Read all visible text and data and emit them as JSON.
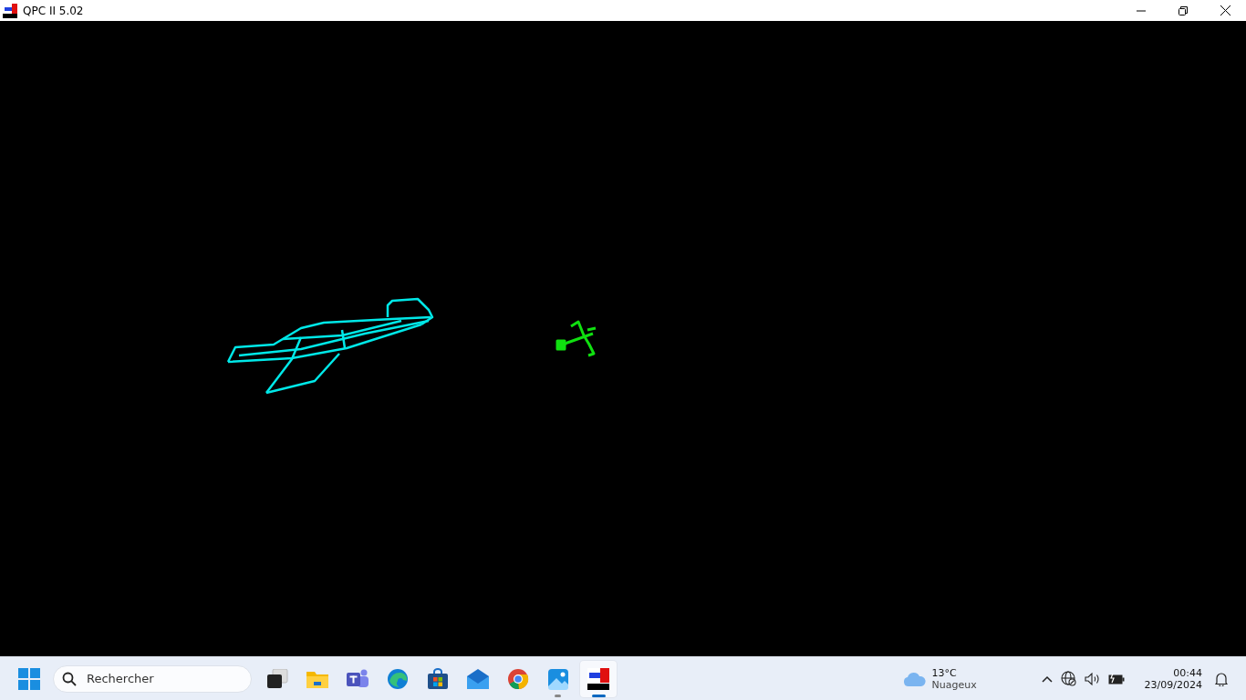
{
  "window": {
    "title": "QPC II 5.02"
  },
  "taskbar": {
    "search": {
      "placeholder": "Rechercher"
    },
    "apps": [
      {
        "kind": "taskview",
        "running": false,
        "selected": false
      },
      {
        "kind": "folder",
        "running": false,
        "selected": false
      },
      {
        "kind": "chat",
        "running": false,
        "selected": false
      },
      {
        "kind": "edge",
        "running": false,
        "selected": false
      },
      {
        "kind": "store",
        "running": false,
        "selected": false
      },
      {
        "kind": "mail",
        "running": false,
        "selected": false
      },
      {
        "kind": "chrome",
        "running": false,
        "selected": false
      },
      {
        "kind": "photos",
        "running": true,
        "selected": false
      },
      {
        "kind": "emulator",
        "running": true,
        "selected": true
      }
    ],
    "weather": {
      "temperature": "13°C",
      "condition": "Nuageux"
    },
    "clock": {
      "time": "00:44",
      "date": "23/09/2024"
    }
  }
}
